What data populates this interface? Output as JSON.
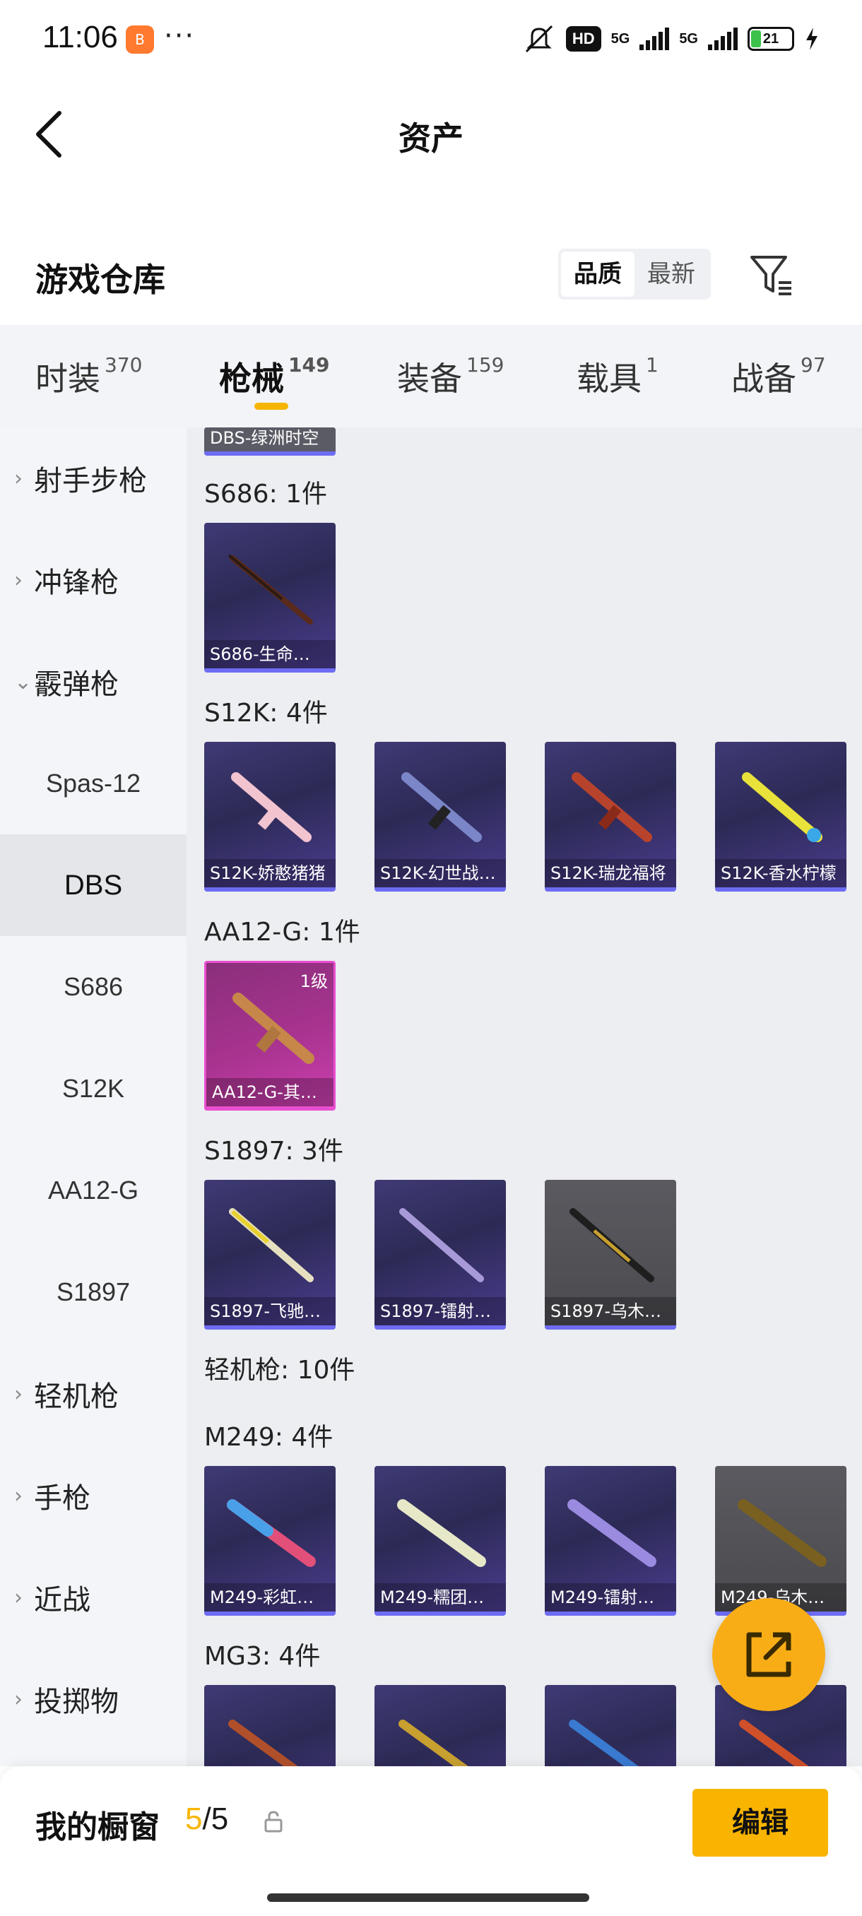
{
  "status_bar": {
    "time": "11:06",
    "app_badge": "B",
    "more": "···",
    "hd": "HD",
    "net1": "5G",
    "net2": "5G",
    "battery": "21"
  },
  "header": {
    "title": "资产",
    "back_icon": "chevron-left-icon"
  },
  "warehouse": {
    "title": "游戏仓库",
    "sort_options": [
      "品质",
      "最新"
    ],
    "active_sort": "品质",
    "filter_icon": "filter-icon"
  },
  "tabs": [
    {
      "label": "时装",
      "count": "370"
    },
    {
      "label": "枪械",
      "count": "149",
      "active": true
    },
    {
      "label": "装备",
      "count": "159"
    },
    {
      "label": "载具",
      "count": "1"
    },
    {
      "label": "战备",
      "count": "97"
    }
  ],
  "sidebar": [
    {
      "label": "射手步枪",
      "type": "category",
      "chevron": "›"
    },
    {
      "label": "冲锋枪",
      "type": "category",
      "chevron": "›"
    },
    {
      "label": "霰弹枪",
      "type": "category",
      "expanded": true,
      "chevron": "⌄"
    },
    {
      "label": "Spas-12",
      "type": "sub"
    },
    {
      "label": "DBS",
      "type": "sub",
      "selected": true
    },
    {
      "label": "S686",
      "type": "sub"
    },
    {
      "label": "S12K",
      "type": "sub"
    },
    {
      "label": "AA12-G",
      "type": "sub"
    },
    {
      "label": "S1897",
      "type": "sub"
    },
    {
      "label": "轻机枪",
      "type": "category",
      "chevron": "›"
    },
    {
      "label": "手枪",
      "type": "category",
      "chevron": "›"
    },
    {
      "label": "近战",
      "type": "category",
      "chevron": "›"
    },
    {
      "label": "投掷物",
      "type": "category",
      "chevron": "›"
    }
  ],
  "content": {
    "top_partial_card": "DBS-绿洲时空",
    "groups": [
      {
        "label": "S686: 1件",
        "items": [
          {
            "name": "S686-生命…",
            "style": "purple"
          }
        ]
      },
      {
        "label": "S12K: 4件",
        "items": [
          {
            "name": "S12K-娇憨猪猪",
            "style": "purple"
          },
          {
            "name": "S12K-幻世战…",
            "style": "purple"
          },
          {
            "name": "S12K-瑞龙福将",
            "style": "purple"
          },
          {
            "name": "S12K-香水柠檬",
            "style": "purple"
          }
        ]
      },
      {
        "label": "AA12-G: 1件",
        "items": [
          {
            "name": "AA12-G-其…",
            "style": "pink",
            "level": "1级"
          }
        ]
      },
      {
        "label": "S1897: 3件",
        "items": [
          {
            "name": "S1897-飞驰…",
            "style": "purple"
          },
          {
            "name": "S1897-镭射…",
            "style": "purple"
          },
          {
            "name": "S1897-乌木…",
            "style": "gray"
          }
        ]
      },
      {
        "label": "轻机枪: 10件",
        "items": []
      },
      {
        "label": "M249: 4件",
        "items": [
          {
            "name": "M249-彩虹…",
            "style": "purple"
          },
          {
            "name": "M249-糯团…",
            "style": "purple"
          },
          {
            "name": "M249-镭射…",
            "style": "purple"
          },
          {
            "name": "M249-乌木…",
            "style": "gray"
          }
        ]
      },
      {
        "label": "MG3: 4件",
        "items": [
          {
            "name": "",
            "style": "purple"
          },
          {
            "name": "",
            "style": "purple"
          },
          {
            "name": "",
            "style": "purple"
          },
          {
            "name": "",
            "style": "purple"
          }
        ]
      }
    ]
  },
  "fab": {
    "icon": "share-external-icon"
  },
  "bottom_bar": {
    "title": "我的橱窗",
    "current": "5",
    "total": "/5",
    "edit_label": "编辑"
  },
  "colors": {
    "accent": "#f6b500",
    "card_purple": "#3f3a75",
    "card_pink": "#a8338f",
    "card_gray": "#55555a",
    "card_border": "#6e6cf2"
  }
}
